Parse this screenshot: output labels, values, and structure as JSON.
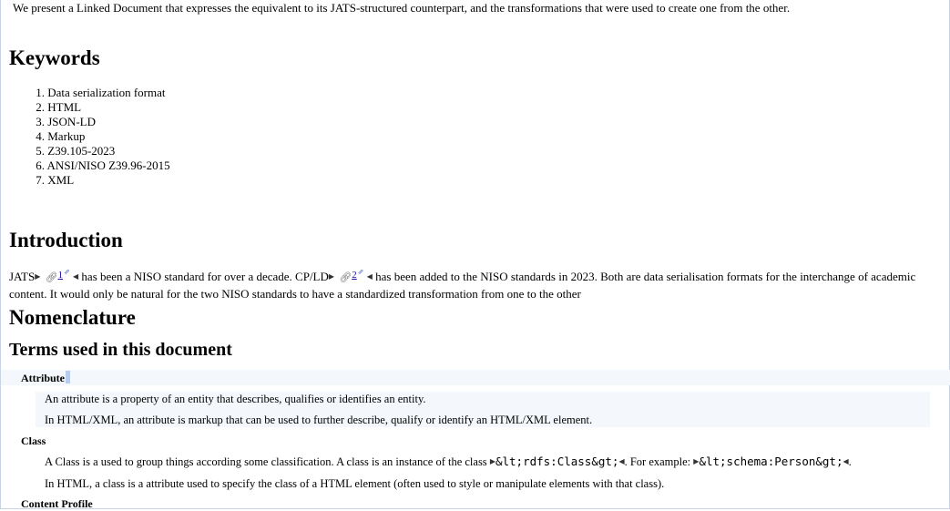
{
  "abstract": {
    "text": "We present a Linked Document that expresses the equivalent to its JATS-structured counterpart, and the transformations that were used to create one from the other."
  },
  "keywords": {
    "heading": "Keywords",
    "items": [
      {
        "num": "1.",
        "label": "Data serialization format"
      },
      {
        "num": "2.",
        "label": "HTML"
      },
      {
        "num": "3.",
        "label": "JSON-LD"
      },
      {
        "num": "4.",
        "label": "Markup"
      },
      {
        "num": "5.",
        "label": "Z39.105-2023"
      },
      {
        "num": "6.",
        "label": "ANSI/NISO Z39.96-2015"
      },
      {
        "num": "7.",
        "label": "XML"
      }
    ]
  },
  "introduction": {
    "heading": "Introduction",
    "term1": "JATS",
    "ref1": "1",
    "text1": "has been a NISO standard for over a decade. CP/LD",
    "ref2": "2",
    "text2": "has been added to the NISO standards in 2023. Both are data serialisation formats for the interchange of academic content. It would only be natural for the two NISO standards to have a standardized transformation from one to the other"
  },
  "nomenclature": {
    "heading": "Nomenclature",
    "subheading": "Terms used in this document",
    "terms": {
      "attribute": {
        "title": "Attribute",
        "def1": "An attribute is a property of an entity that describes, qualifies or identifies an entity.",
        "def2": "In HTML/XML, an attribute is markup that can be used to further describe, qualify or identify an HTML/XML element."
      },
      "class": {
        "title": "Class",
        "def1_pre": "A Class is a used to group things according some classification. A class is an instance of the class",
        "def1_code1": "&lt;rdfs:Class&gt;",
        "def1_mid": ". For example:",
        "def1_code2": "&lt;schema:Person&gt;",
        "def1_post": ".",
        "def2": "In HTML, a class is a attribute used to specify the class of a HTML element (often used to style or manipulate elements with that class)."
      },
      "content_profile": {
        "title": "Content Profile"
      }
    }
  },
  "icons": {
    "open_marker": "open-marker-icon",
    "close_marker": "close-marker-icon",
    "link": "link-icon",
    "external": "external-link-icon"
  },
  "colors": {
    "link": "#1a0dab",
    "highlight_bg": "#f4f7fb",
    "selection": "#b7cdf0"
  }
}
